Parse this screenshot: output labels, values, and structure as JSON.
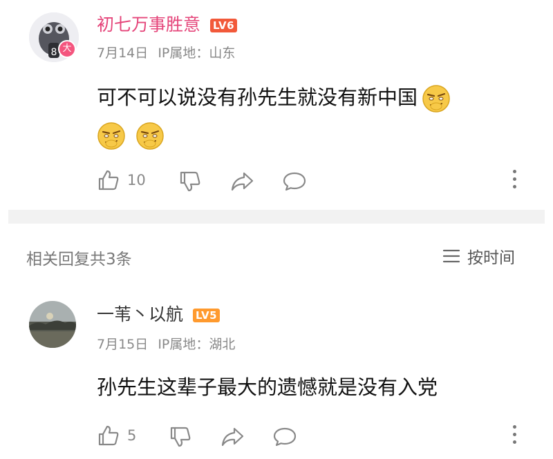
{
  "main_comment": {
    "username": "初七万事胜意",
    "level": "LV6",
    "level_color": "#f2593a",
    "date": "7月14日",
    "ip_location": "IP属地：山东",
    "text": "可不可以说没有孙先生就没有新中国",
    "emoji_count": 3,
    "emoji": "smirk-emoji",
    "like_count": "10",
    "avatar_badge": "大"
  },
  "replies_header": {
    "label": "相关回复共3条",
    "sort_label": "按时间"
  },
  "reply": {
    "username": "一苇丶以航",
    "level": "LV5",
    "level_color": "#ff9a2e",
    "date": "7月15日",
    "ip_location": "IP属地：湖北",
    "text": "孙先生这辈子最大的遗憾就是没有入党",
    "like_count": "5"
  },
  "colors": {
    "username": "#e5457a",
    "meta": "#888888",
    "divider": "#f2f2f2"
  }
}
